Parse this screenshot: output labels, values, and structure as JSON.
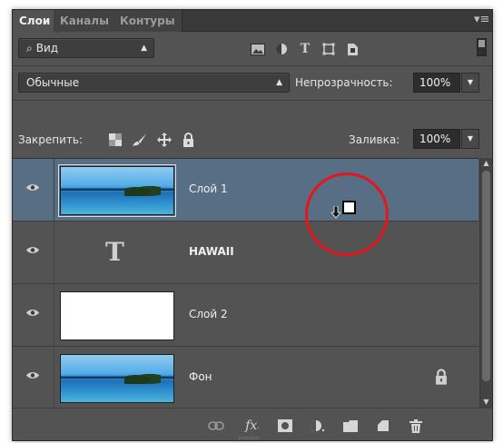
{
  "tabs": [
    {
      "label": "Слои",
      "active": true
    },
    {
      "label": "Каналы",
      "active": false
    },
    {
      "label": "Контуры",
      "active": false
    }
  ],
  "panel_menu_icon": "panel-menu-icon",
  "filter": {
    "kind_label": "Вид",
    "icons": [
      "image-filter-icon",
      "adjustment-filter-icon",
      "type-filter-icon",
      "shape-filter-icon",
      "smart-object-filter-icon"
    ]
  },
  "blend": {
    "mode": "Обычные",
    "opacity_label": "Непрозрачность:",
    "opacity_value": "100%"
  },
  "lock": {
    "label": "Закрепить:",
    "fill_label": "Заливка:",
    "fill_value": "100%",
    "icons": [
      "lock-transparent-icon",
      "lock-image-icon",
      "lock-position-icon",
      "lock-all-icon"
    ]
  },
  "layers": [
    {
      "name": "Слой 1",
      "selected": true,
      "thumb": "ocean",
      "locked": false
    },
    {
      "name": "HAWAII",
      "selected": false,
      "thumb": "type",
      "locked": false
    },
    {
      "name": "Слой 2",
      "selected": false,
      "thumb": "white",
      "locked": false
    },
    {
      "name": "Фон",
      "selected": false,
      "thumb": "ocean",
      "locked": true
    }
  ],
  "bottom_tools": [
    "link-layers-icon",
    "fx-icon",
    "add-mask-icon",
    "adjustment-layer-icon",
    "new-group-icon",
    "new-layer-icon",
    "trash-icon"
  ],
  "colors": {
    "panel_bg": "#535353",
    "selected_row": "#586e85",
    "annotation": "#e8141b"
  }
}
